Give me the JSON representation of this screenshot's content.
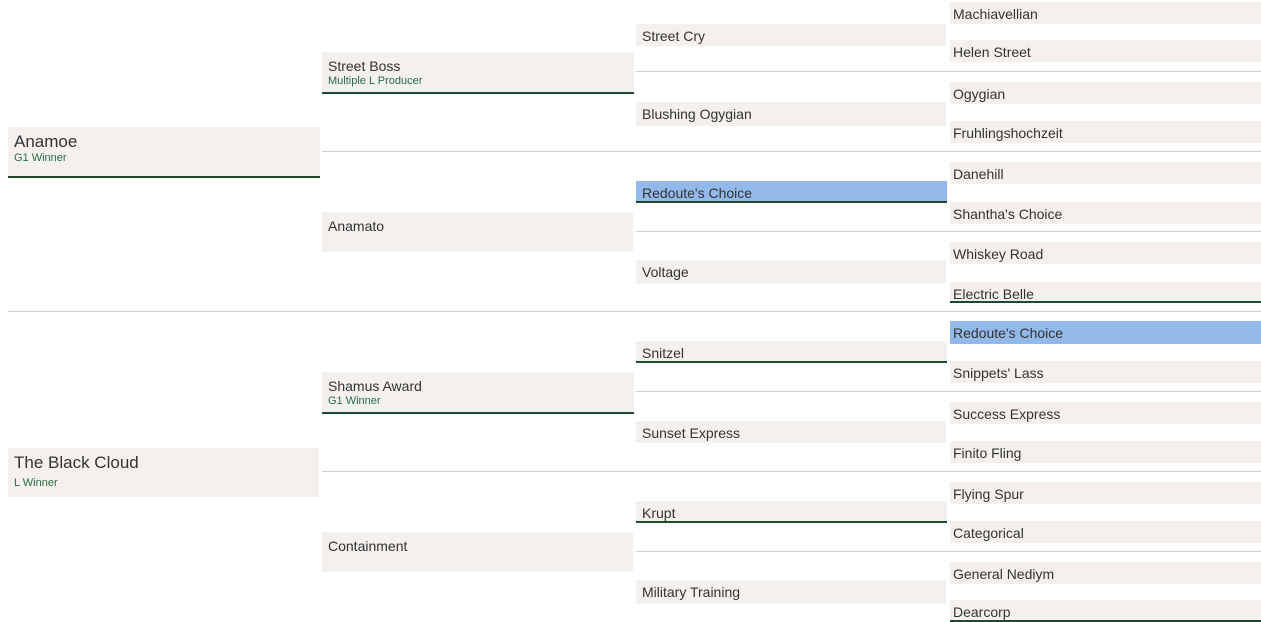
{
  "pedigree": {
    "g1": [
      {
        "name": "Anamoe",
        "honour": "G1 Winner"
      },
      {
        "name": "The Black Cloud",
        "honour": "L Winner"
      }
    ],
    "g2": [
      {
        "name": "Street Boss",
        "honour": "Multiple L Producer"
      },
      {
        "name": "Anamato",
        "honour": ""
      },
      {
        "name": "Shamus Award",
        "honour": "G1 Winner"
      },
      {
        "name": "Containment",
        "honour": ""
      }
    ],
    "g3": [
      {
        "name": "Street Cry"
      },
      {
        "name": "Blushing Ogygian"
      },
      {
        "name": "Redoute's Choice"
      },
      {
        "name": "Voltage"
      },
      {
        "name": "Snitzel"
      },
      {
        "name": "Sunset Express"
      },
      {
        "name": "Krupt"
      },
      {
        "name": "Military Training"
      }
    ],
    "g4": [
      {
        "name": "Machiavellian"
      },
      {
        "name": "Helen Street"
      },
      {
        "name": "Ogygian"
      },
      {
        "name": "Fruhlingshochzeit"
      },
      {
        "name": "Danehill"
      },
      {
        "name": "Shantha's Choice"
      },
      {
        "name": "Whiskey Road"
      },
      {
        "name": "Electric Belle"
      },
      {
        "name": "Redoute's Choice"
      },
      {
        "name": "Snippets' Lass"
      },
      {
        "name": "Success Express"
      },
      {
        "name": "Finito Fling"
      },
      {
        "name": "Flying Spur"
      },
      {
        "name": "Categorical"
      },
      {
        "name": "General Nediym"
      },
      {
        "name": "Dearcorp"
      }
    ]
  },
  "colors": {
    "cell_bg": "#f3f0ed",
    "highlight": "#93b9ea",
    "honour_text": "#2b6b45",
    "underline": "#1d4a2e",
    "separator": "#cfcfcf"
  }
}
